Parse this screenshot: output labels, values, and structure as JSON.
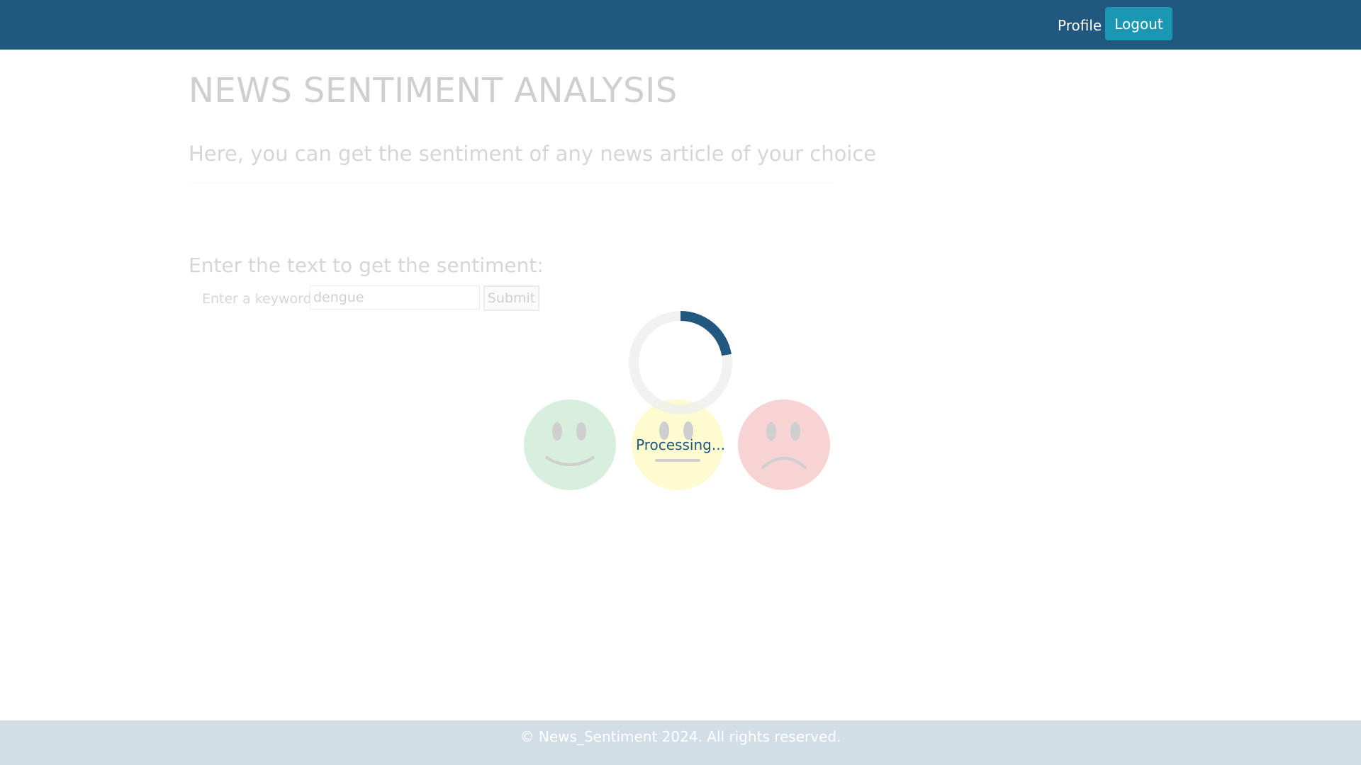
{
  "navbar": {
    "profile_label": "Profile",
    "logout_label": "Logout",
    "background_color": "#21587f",
    "logout_color": "#1a98b3"
  },
  "header": {
    "title": "NEWS SENTIMENT ANALYSIS",
    "subtitle": "Here, you can get the sentiment of any news article of your choice"
  },
  "form": {
    "heading": "Enter the text to get the sentiment:",
    "keyword_label": "Enter a keyword:",
    "keyword_value": "dengue",
    "submit_label": "Submit"
  },
  "loading": {
    "text": "Processing...",
    "spinner_color": "#21587f"
  },
  "sentiments": {
    "positive_color": "#d8efdd",
    "neutral_color": "#fdfbcf",
    "negative_color": "#f8d3d4"
  },
  "footer": {
    "text": "© News_Sentiment 2024. All rights reserved."
  }
}
